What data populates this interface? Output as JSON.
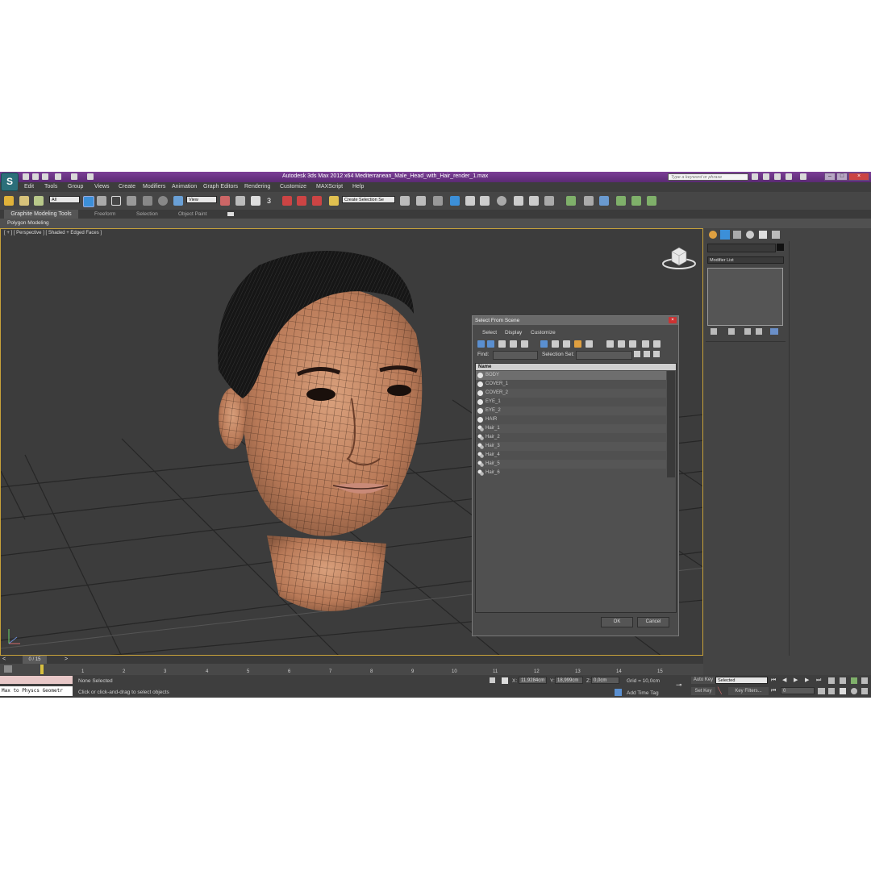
{
  "window": {
    "title": "Autodesk 3ds Max  2012 x64     Mediterranean_Male_Head_with_Hair_render_1.max",
    "search_placeholder": "Type a keyword or phrase",
    "logo": "S"
  },
  "menu": [
    "Edit",
    "Tools",
    "Group",
    "Views",
    "Create",
    "Modifiers",
    "Animation",
    "Graph Editors",
    "Rendering",
    "Customize",
    "MAXScript",
    "Help"
  ],
  "toolbar": {
    "selection_filter": "All",
    "ref_coord": "View",
    "named_selection": "Create Selection Se",
    "snap_label": "3"
  },
  "ribbon": {
    "tabs": [
      "Graphite Modeling Tools",
      "Freeform",
      "Selection",
      "Object Paint"
    ],
    "subtab": "Polygon Modeling"
  },
  "viewport": {
    "label": "[ + ] [ Perspective ] [ Shaded + Edged Faces ]"
  },
  "command_panel": {
    "modifier_list": "Modifier List"
  },
  "dialog": {
    "title": "Select From Scene",
    "menu": [
      "Select",
      "Display",
      "Customize"
    ],
    "find_label": "Find:",
    "selection_set_label": "Selection Set:",
    "column_name": "Name",
    "items": [
      "BODY",
      "COVER_1",
      "COVER_2",
      "EYE_1",
      "EYE_2",
      "HAIR",
      "Hair_1",
      "Hair_2",
      "Hair_3",
      "Hair_4",
      "Hair_5",
      "Hair_6"
    ],
    "ok": "OK",
    "cancel": "Cancel"
  },
  "timeline": {
    "frame": "0 / 15",
    "ticks": [
      "1",
      "2",
      "3",
      "4",
      "5",
      "6",
      "7",
      "8",
      "9",
      "10",
      "11",
      "12",
      "13",
      "14",
      "15"
    ]
  },
  "status": {
    "maxscript_listener": "Max to Physcs Geometr",
    "selection": "None Selected",
    "prompt": "Click or click-and-drag to select objects",
    "x_label": "X:",
    "x_value": "11,9284cm",
    "y_label": "Y:",
    "y_value": "18,999cm",
    "z_label": "Z:",
    "z_value": "0,0cm",
    "grid": "Grid = 10,0cm",
    "add_time_tag": "Add Time Tag",
    "auto_key": "Auto Key",
    "set_key": "Set Key",
    "key_mode": "Selected",
    "key_filters": "Key Filters...",
    "current_frame": "0"
  }
}
